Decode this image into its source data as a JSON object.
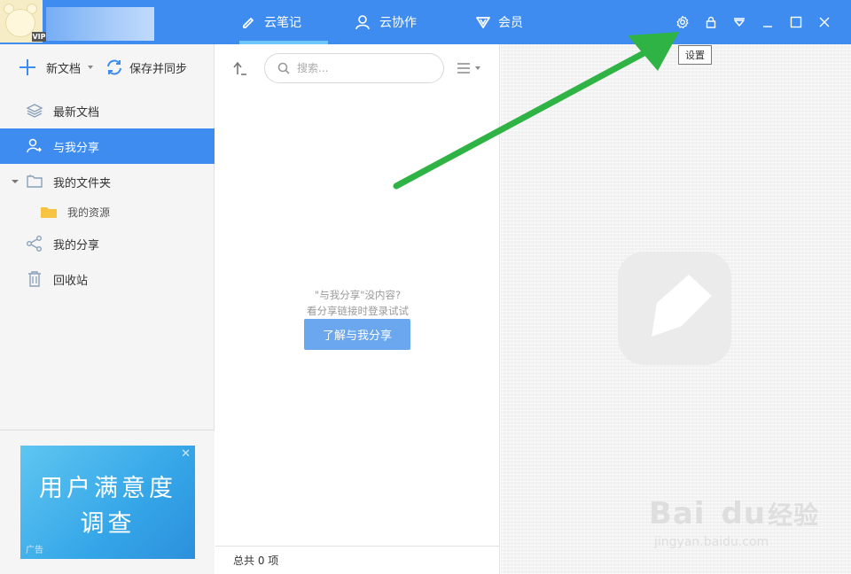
{
  "topbar": {
    "vip_badge": "VIP",
    "tabs": [
      {
        "label": "云笔记",
        "icon": "pen-icon",
        "active": true
      },
      {
        "label": "云协作",
        "icon": "collab-user-icon",
        "active": false
      },
      {
        "label": "会员",
        "icon": "vip-v-icon",
        "active": false
      }
    ],
    "window_buttons": [
      "settings-gear-icon",
      "lock-icon",
      "dropdown-triangle-icon",
      "minimize-icon",
      "maximize-icon",
      "close-icon"
    ],
    "tooltip": "设置",
    "colors": {
      "bar": "#3e8cf0",
      "tab_underline": "#6ec8ff"
    }
  },
  "sidebar": {
    "new_doc_label": "新文档",
    "sync_label": "保存并同步",
    "items": [
      {
        "label": "最新文档",
        "icon": "layers-icon",
        "active": false
      },
      {
        "label": "与我分享",
        "icon": "shared-user-icon",
        "active": true
      },
      {
        "label": "我的文件夹",
        "icon": "folder-outline-icon",
        "active": false
      },
      {
        "label": "我的资源",
        "icon": "folder-yellow-icon",
        "active": false
      },
      {
        "label": "我的分享",
        "icon": "share-icon",
        "active": false
      },
      {
        "label": "回收站",
        "icon": "trash-icon",
        "active": false
      }
    ],
    "ad": {
      "title_line1": "用户满意度",
      "title_line2": "调查",
      "tag": "广告",
      "close": "✕"
    }
  },
  "list": {
    "search_placeholder": "搜索...",
    "empty_line1": "\"与我分享\"没内容?",
    "empty_line2": "看分享链接时登录试试",
    "learn_button": "了解与我分享",
    "footer_total": "总共 0 项"
  },
  "watermark": {
    "main": "Bai",
    "du": "du",
    "suffix": "经验",
    "url": "jingyan.baidu.com"
  }
}
